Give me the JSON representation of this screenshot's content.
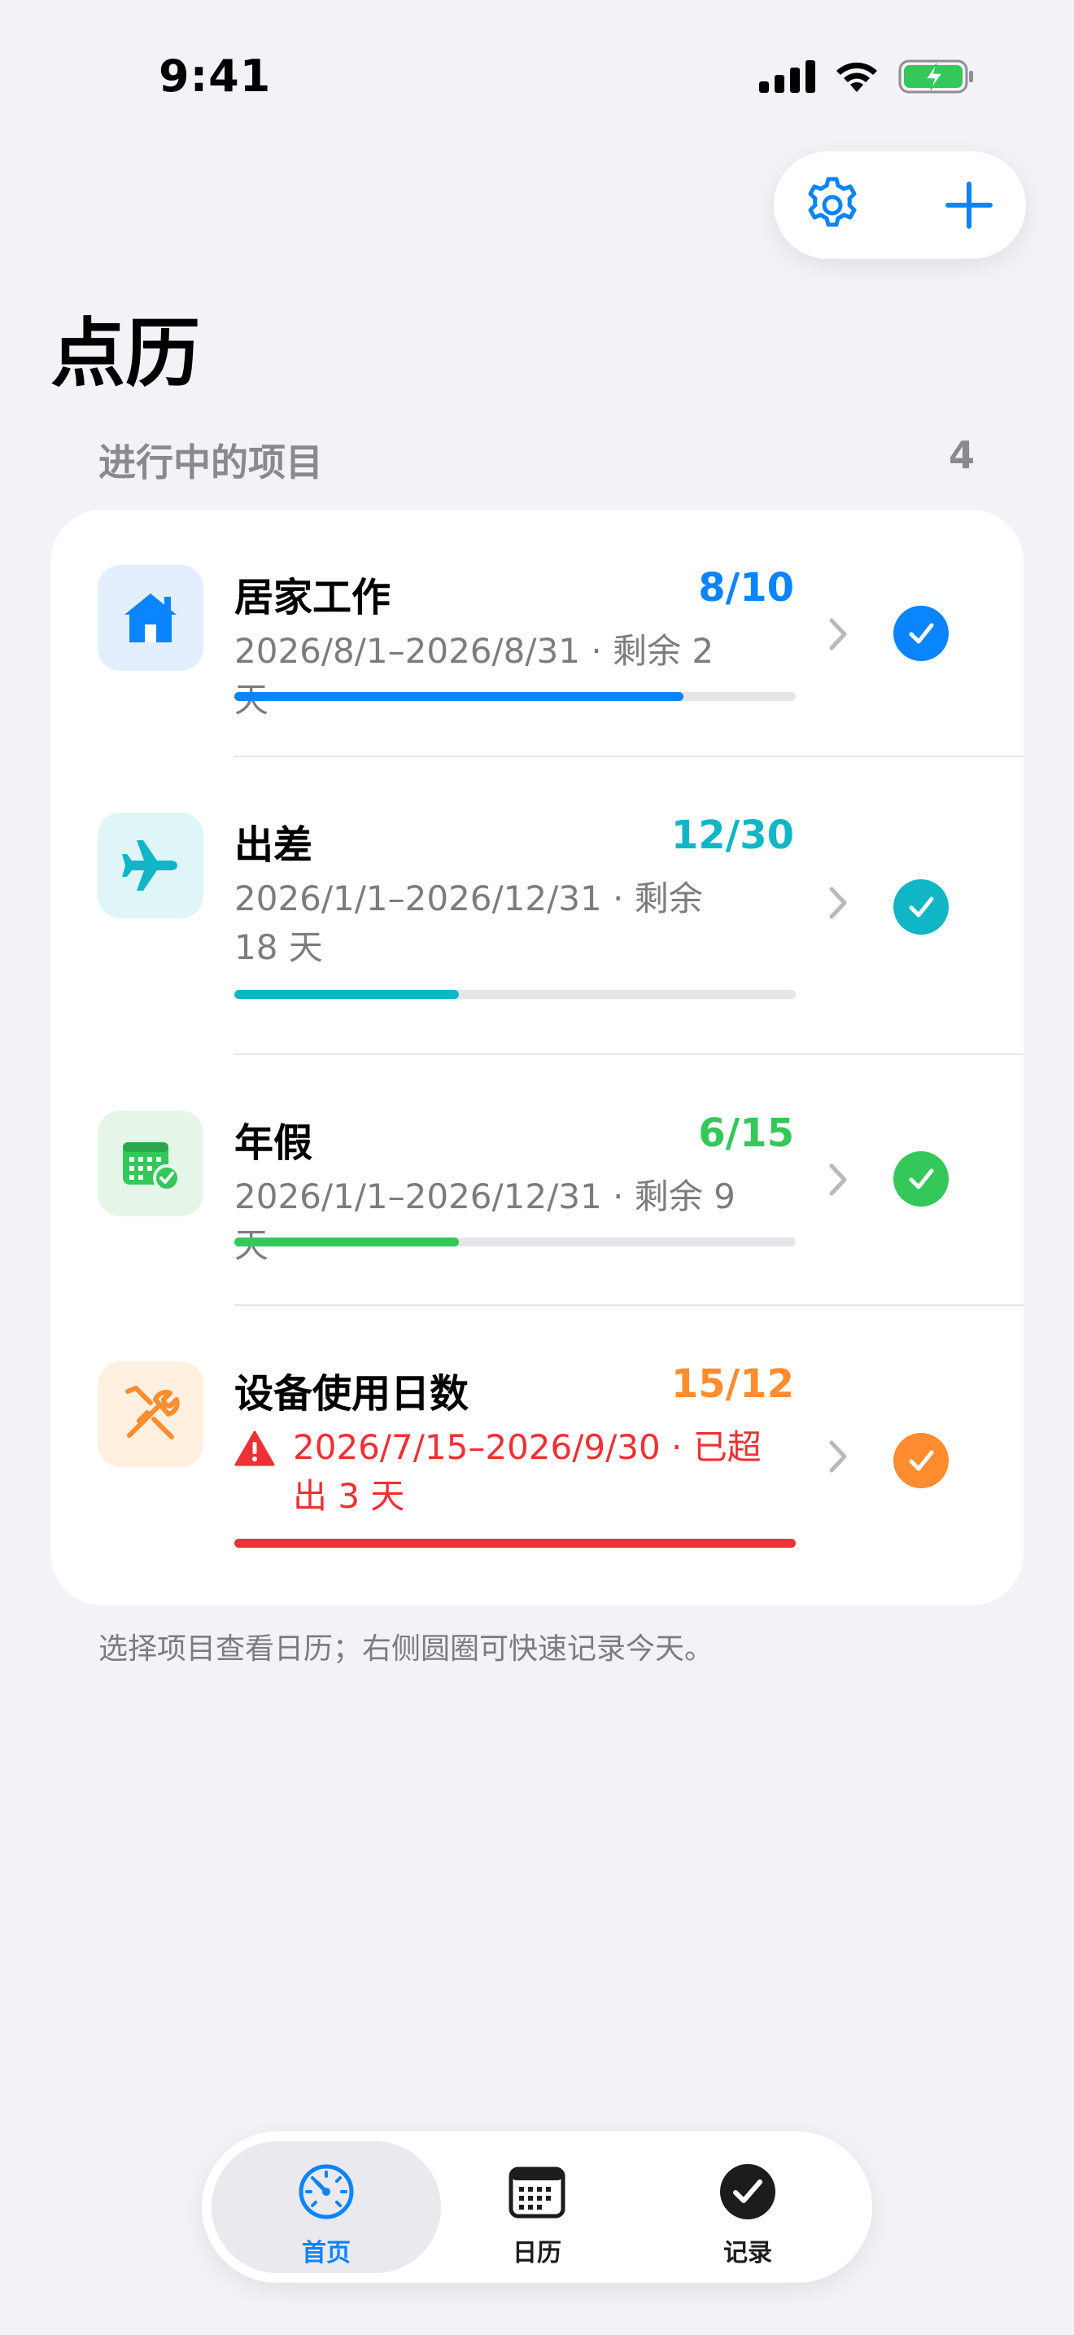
{
  "status": {
    "time": "9:41"
  },
  "title": "点历",
  "section": {
    "label": "进行中的项目",
    "count": "4"
  },
  "projects": [
    {
      "name": "居家工作",
      "count": "8/10",
      "subtitle": "2026/8/1–2026/8/31 · 剩余 2 天",
      "progress": 0.8,
      "color": "#0a84ff",
      "icon_bg": "#e3efff",
      "icon": "house-icon",
      "overdue": false
    },
    {
      "name": "出差",
      "count": "12/30",
      "subtitle": "2026/1/1–2026/12/31 · 剩余 18 天",
      "progress": 0.4,
      "color": "#11b6c6",
      "icon_bg": "#dff5f7",
      "icon": "airplane-icon",
      "overdue": false
    },
    {
      "name": "年假",
      "count": "6/15",
      "subtitle": "2026/1/1–2026/12/31 · 剩余 9 天",
      "progress": 0.4,
      "color": "#34c759",
      "icon_bg": "#e5f6e9",
      "icon": "calendar-check-icon",
      "overdue": false
    },
    {
      "name": "设备使用日数",
      "count": "15/12",
      "subtitle": "2026/7/15–2026/9/30 · 已超出 3 天",
      "progress": 1.0,
      "color": "#ff8c2e",
      "icon_bg": "#fff0e0",
      "icon": "tools-icon",
      "overdue": true,
      "overdue_color": "#ef3034"
    }
  ],
  "footnote": "选择项目查看日历；右侧圆圈可快速记录今天。",
  "tabs": [
    {
      "label": "首页",
      "icon": "dashboard-icon",
      "active": true
    },
    {
      "label": "日历",
      "icon": "calendar-icon",
      "active": false
    },
    {
      "label": "记录",
      "icon": "checkmark-circle-icon",
      "active": false
    }
  ],
  "colors": {
    "accent": "#0a84ff",
    "background": "#f2f2f7"
  }
}
